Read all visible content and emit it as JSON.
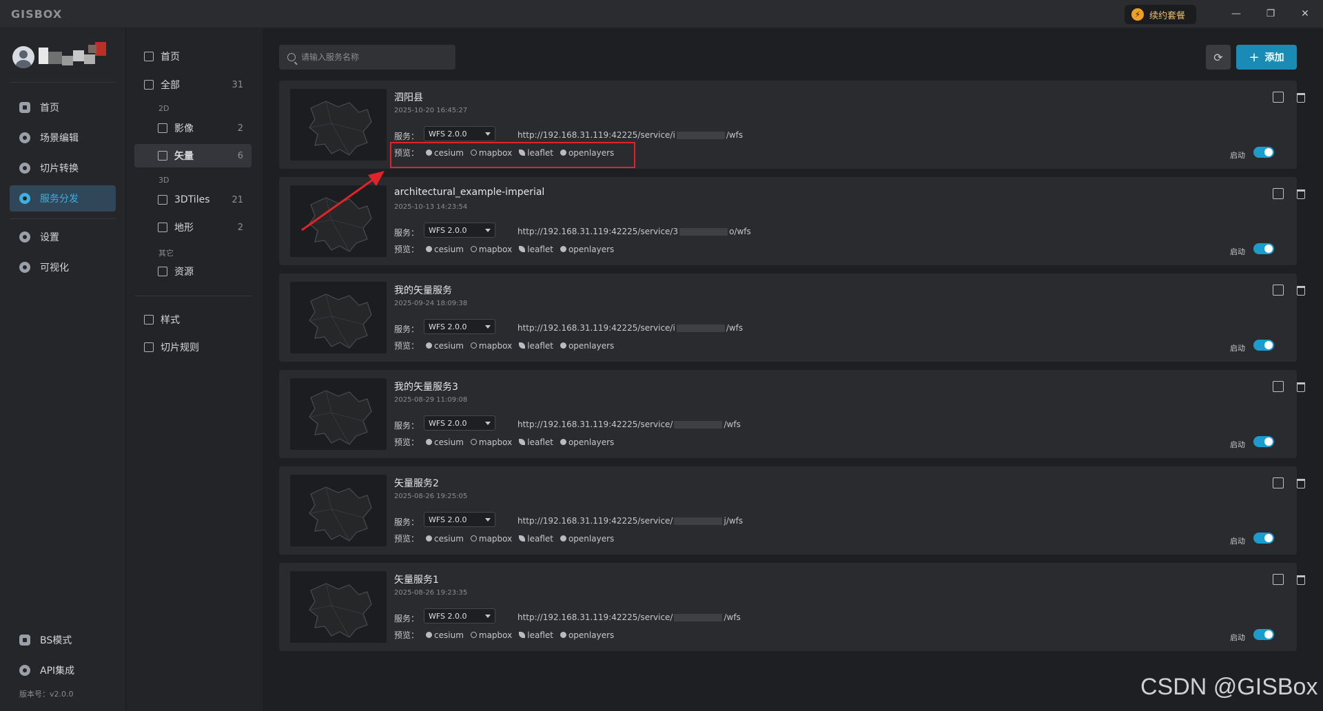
{
  "app": {
    "logo": "GISBOX",
    "renew_label": "续约套餐",
    "renew_icon": "bolt-icon",
    "window_controls": [
      "—",
      "❐",
      "✕"
    ]
  },
  "sidebar": {
    "items": [
      {
        "label": "首页",
        "icon": "home-icon"
      },
      {
        "label": "场景编辑",
        "icon": "cube-icon"
      },
      {
        "label": "切片转换",
        "icon": "swap-icon"
      },
      {
        "label": "服务分发",
        "icon": "upload-icon",
        "active": true
      },
      {
        "label": "设置",
        "icon": "gear-icon"
      },
      {
        "label": "可视化",
        "icon": "chart-icon"
      }
    ],
    "bottom": [
      {
        "label": "BS模式",
        "icon": "code-icon"
      },
      {
        "label": "API集成",
        "icon": "api-icon"
      }
    ],
    "version": "版本号：v2.0.0"
  },
  "categories": {
    "home": "首页",
    "all": {
      "label": "全部",
      "count": "31"
    },
    "group_2d": "2D",
    "image": {
      "label": "影像",
      "count": "2"
    },
    "vector": {
      "label": "矢量",
      "count": "6"
    },
    "group_3d": "3D",
    "tiles3d": {
      "label": "3DTiles",
      "count": "21"
    },
    "terrain": {
      "label": "地形",
      "count": "2"
    },
    "group_other": "其它",
    "resource": "资源",
    "style": "样式",
    "tile_rules": "切片规则"
  },
  "toolbar": {
    "search_placeholder": "请输入服务名称",
    "refresh_icon": "⟳",
    "add_plus": "+",
    "add_label": "添加"
  },
  "labels": {
    "service": "服务：",
    "preview": "预览：",
    "enable": "启动",
    "wfs_version": "WFS 2.0.0",
    "preview_links": [
      "cesium",
      "mapbox",
      "leaflet",
      "openlayers"
    ]
  },
  "services": [
    {
      "name": "泗阳县",
      "date": "2025-10-20 16:45:27",
      "url_prefix": "http://192.168.31.119:42225/service/i",
      "url_suffix": "/wfs"
    },
    {
      "name": "architectural_example-imperial",
      "date": "2025-10-13 14:23:54",
      "url_prefix": "http://192.168.31.119:42225/service/3",
      "url_suffix": "o/wfs"
    },
    {
      "name": "我的矢量服务",
      "date": "2025-09-24 18:09:38",
      "url_prefix": "http://192.168.31.119:42225/service/i",
      "url_suffix": "/wfs"
    },
    {
      "name": "我的矢量服务3",
      "date": "2025-08-29 11:09:08",
      "url_prefix": "http://192.168.31.119:42225/service/",
      "url_suffix": "/wfs"
    },
    {
      "name": "矢量服务2",
      "date": "2025-08-26 19:25:05",
      "url_prefix": "http://192.168.31.119:42225/service/",
      "url_suffix": "j/wfs"
    },
    {
      "name": "矢量服务1",
      "date": "2025-08-26 19:23:35",
      "url_prefix": "http://192.168.31.119:42225/service/",
      "url_suffix": "/wfs"
    }
  ],
  "watermark": "CSDN @GISBox",
  "colors": {
    "accent": "#1a9ccc",
    "annotation": "#e0242a"
  }
}
